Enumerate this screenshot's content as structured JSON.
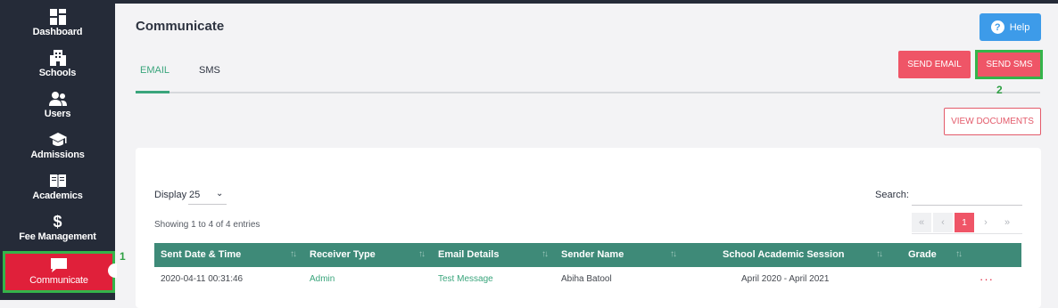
{
  "sidebar": {
    "items": [
      {
        "label": "Dashboard",
        "icon": "dashboard-icon"
      },
      {
        "label": "Schools",
        "icon": "building-icon"
      },
      {
        "label": "Users",
        "icon": "users-icon"
      },
      {
        "label": "Admissions",
        "icon": "graduation-cap-icon"
      },
      {
        "label": "Academics",
        "icon": "book-icon"
      },
      {
        "label": "Fee Management",
        "icon": "dollar-icon"
      },
      {
        "label": "Communicate",
        "icon": "chat-icon",
        "active": true
      }
    ]
  },
  "annotations": {
    "one": "1",
    "two": "2"
  },
  "header": {
    "title": "Communicate",
    "help_label": "Help"
  },
  "tabs": [
    {
      "label": "EMAIL",
      "active": true
    },
    {
      "label": "SMS",
      "active": false
    }
  ],
  "actions": {
    "send_email": "SEND EMAIL",
    "send_sms": "SEND SMS",
    "view_documents": "VIEW DOCUMENTS"
  },
  "table_controls": {
    "display_label": "Display",
    "display_value": "25",
    "search_label": "Search:",
    "search_value": "",
    "showing": "Showing 1 to 4 of 4 entries",
    "current_page": "1"
  },
  "table": {
    "headers": [
      "Sent Date & Time",
      "Receiver Type",
      "Email Details",
      "Sender Name",
      "School Academic Session",
      "Grade"
    ],
    "rows": [
      {
        "sent": "2020-04-11 00:31:46",
        "receiver": "Admin",
        "details": "Test Message",
        "sender": "Abiha Batool",
        "session": "April 2020 - April 2021",
        "grade": ""
      }
    ]
  },
  "colors": {
    "sidebar": "#252b38",
    "accent_red": "#ef5567",
    "table_header": "#3e8a78",
    "link_green": "#3aa57c",
    "help_blue": "#3d9be9"
  }
}
